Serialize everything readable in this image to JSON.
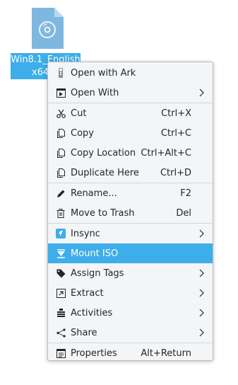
{
  "desktop_file": {
    "label_line1": "Win8.1_English",
    "label_line2": "x64",
    "icon": "disc-image-file-icon"
  },
  "menu": {
    "items": [
      {
        "label": "Open with Ark",
        "shortcut": "",
        "icon": "ark-icon"
      },
      {
        "label": "Open With",
        "shortcut": "",
        "icon": "open-with-icon"
      },
      {
        "label": "Cut",
        "shortcut": "Ctrl+X",
        "icon": "scissors-icon"
      },
      {
        "label": "Copy",
        "shortcut": "Ctrl+C",
        "icon": "copy-icon"
      },
      {
        "label": "Copy Location",
        "shortcut": "Ctrl+Alt+C",
        "icon": "copy-location-icon"
      },
      {
        "label": "Duplicate Here",
        "shortcut": "Ctrl+D",
        "icon": "duplicate-icon"
      },
      {
        "label": "Rename...",
        "shortcut": "F2",
        "icon": "pencil-icon"
      },
      {
        "label": "Move to Trash",
        "shortcut": "Del",
        "icon": "trash-icon"
      },
      {
        "label": "Insync",
        "shortcut": "",
        "icon": "insync-icon"
      },
      {
        "label": "Mount ISO",
        "shortcut": "",
        "icon": "mount-icon"
      },
      {
        "label": "Assign Tags",
        "shortcut": "",
        "icon": "tag-icon"
      },
      {
        "label": "Extract",
        "shortcut": "",
        "icon": "extract-icon"
      },
      {
        "label": "Activities",
        "shortcut": "",
        "icon": "activities-icon"
      },
      {
        "label": "Share",
        "shortcut": "",
        "icon": "share-icon"
      },
      {
        "label": "Properties",
        "shortcut": "Alt+Return",
        "icon": "properties-icon"
      }
    ]
  },
  "colors": {
    "highlight": "#3daee9",
    "text": "#232629",
    "menu_bg": "#f4f5f6"
  }
}
